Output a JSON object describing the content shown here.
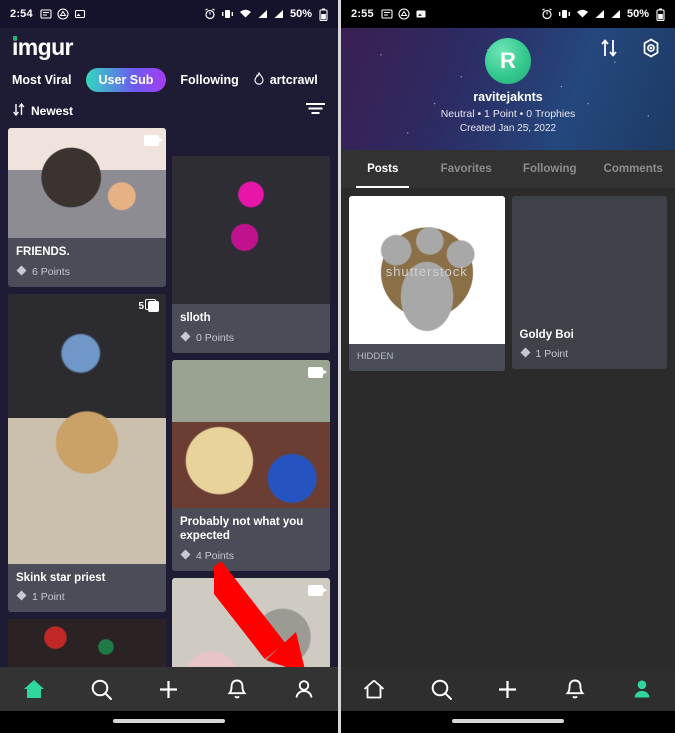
{
  "left": {
    "status": {
      "time": "2:54",
      "battery": "50%",
      "icons": [
        "news-icon",
        "cloud-icon",
        "screenshot-icon",
        "alarm-icon",
        "vibrate-icon",
        "wifi-icon",
        "signal-icon",
        "signal-icon-2",
        "battery-icon"
      ]
    },
    "logo": "imgur",
    "tabs": [
      {
        "label": "Most Viral",
        "active": false
      },
      {
        "label": "User Sub",
        "active": true
      },
      {
        "label": "Following",
        "active": false
      },
      {
        "label": "artcrawl",
        "active": false,
        "icon": "flame-icon"
      }
    ],
    "sort": {
      "label": "Newest",
      "icon": "sort-arrows-icon",
      "filter_icon": "filter-icon"
    },
    "column_left": [
      {
        "title": "FRIENDS.",
        "points": "6 Points",
        "badge": "video",
        "badge_count": ""
      },
      {
        "title": "Skink star priest",
        "points": "1 Point",
        "badge": "album",
        "badge_count": "5"
      },
      {
        "title": "",
        "points": "",
        "badge": "",
        "badge_count": ""
      }
    ],
    "column_right": [
      {
        "title": "slloth",
        "points": "0 Points",
        "badge": "",
        "badge_count": ""
      },
      {
        "title": "Probably not what you expected",
        "points": "4 Points",
        "badge": "video",
        "badge_count": ""
      },
      {
        "title": "",
        "points": "",
        "badge": "video",
        "badge_count": ""
      }
    ],
    "nav": [
      {
        "name": "home",
        "active": true
      },
      {
        "name": "search",
        "active": false
      },
      {
        "name": "add",
        "active": false
      },
      {
        "name": "notifications",
        "active": false
      },
      {
        "name": "profile",
        "active": false
      }
    ]
  },
  "right": {
    "status": {
      "time": "2:55",
      "battery": "50%"
    },
    "profile": {
      "avatar_letter": "R",
      "username": "ravitejaknts",
      "stats": "Neutral • 1 Point • 0 Trophies",
      "created": "Created Jan 25, 2022",
      "sort_icon": "sort-arrows-icon",
      "settings_icon": "settings-gear-icon"
    },
    "tabs": [
      {
        "label": "Posts",
        "active": true
      },
      {
        "label": "Favorites",
        "active": false
      },
      {
        "label": "Following",
        "active": false
      },
      {
        "label": "Comments",
        "active": false
      }
    ],
    "posts_left": [
      {
        "title": "HIDDEN",
        "points": "",
        "watermark": "shutterstock"
      }
    ],
    "posts_right": [
      {
        "title": "Goldy Boi",
        "points": "1 Point"
      }
    ],
    "nav": [
      {
        "name": "home",
        "active": false
      },
      {
        "name": "search",
        "active": false
      },
      {
        "name": "add",
        "active": false
      },
      {
        "name": "notifications",
        "active": false
      },
      {
        "name": "profile",
        "active": true
      }
    ]
  },
  "annotation": {
    "arrow_color": "#ff0000",
    "points_to": "profile-nav-icon"
  },
  "colors": {
    "accent_teal": "#2fd6a0",
    "pill_start": "#34d8c0",
    "pill_end": "#a63df0",
    "left_bg": "#1e1b35",
    "right_bg": "#2b2b2b",
    "card_bg": "#4a4d57"
  }
}
